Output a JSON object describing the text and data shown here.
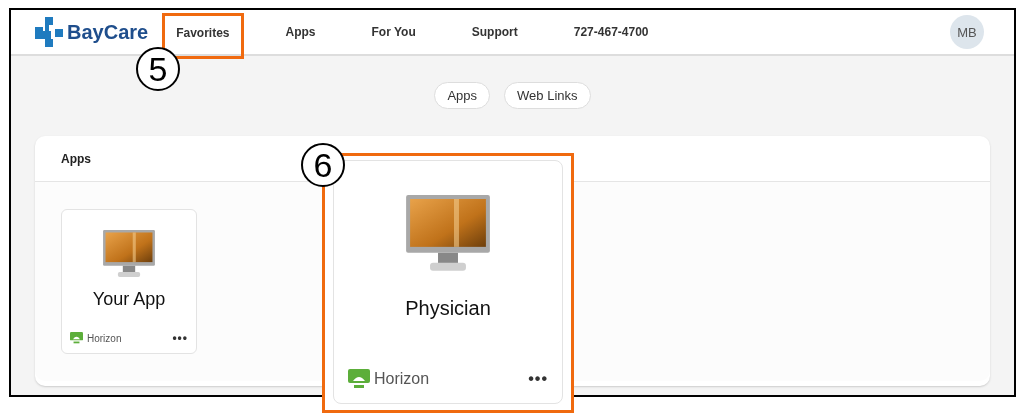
{
  "header": {
    "logo": "BayCare",
    "nav": [
      {
        "label": "Favorites",
        "highlighted": true
      },
      {
        "label": "Apps",
        "highlighted": false
      },
      {
        "label": "For You",
        "highlighted": false
      },
      {
        "label": "Support",
        "highlighted": false
      },
      {
        "label": "727-467-4700",
        "highlighted": false
      }
    ],
    "avatar": "MB"
  },
  "filters": [
    {
      "label": "Apps"
    },
    {
      "label": "Web Links"
    }
  ],
  "section": {
    "title": "Apps",
    "apps": [
      {
        "name": "Your App",
        "provider": "Horizon",
        "menu": "•••"
      }
    ]
  },
  "zoomed_app": {
    "name": "Physician",
    "provider": "Horizon",
    "menu": "•••"
  },
  "callouts": [
    {
      "number": "5"
    },
    {
      "number": "6"
    }
  ]
}
